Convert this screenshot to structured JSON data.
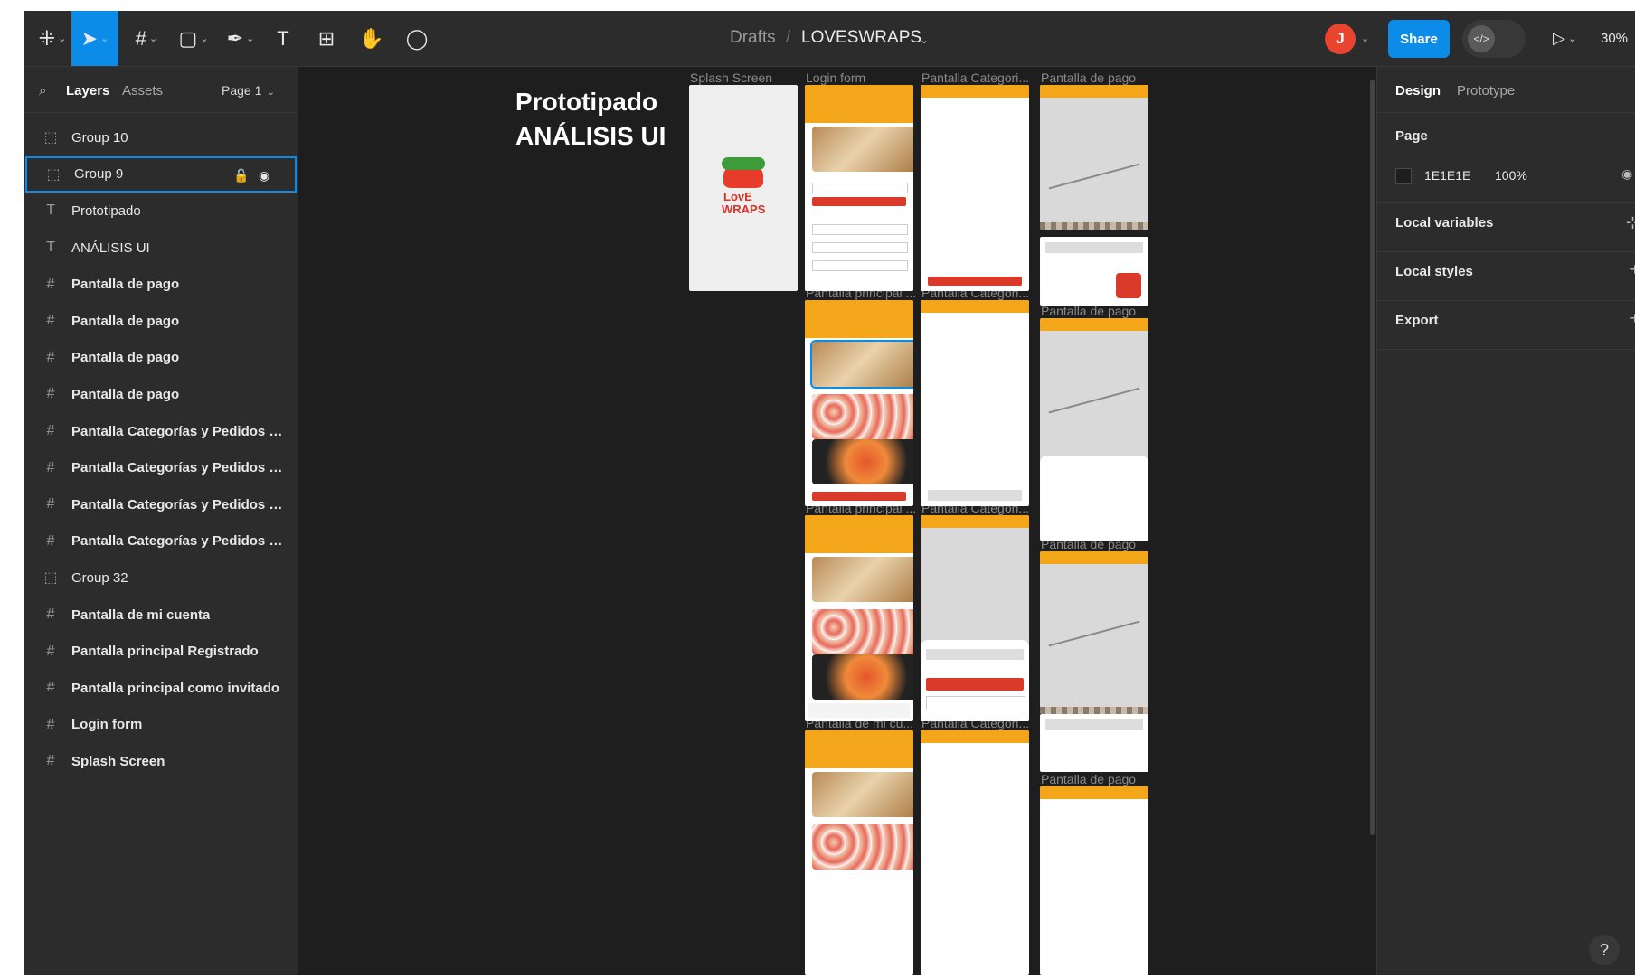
{
  "toolbar": {
    "main_menu_icon": "figma-logo-icon",
    "tools": [
      {
        "name": "move-tool",
        "icon": "pointer-icon",
        "active": true
      },
      {
        "name": "frame-tool",
        "icon": "hash-icon"
      },
      {
        "name": "shape-tool",
        "icon": "rectangle-icon"
      },
      {
        "name": "pen-tool",
        "icon": "pen-icon"
      },
      {
        "name": "text-tool",
        "icon": "text-icon"
      },
      {
        "name": "resources-tool",
        "icon": "components-icon"
      },
      {
        "name": "hand-tool",
        "icon": "hand-icon"
      },
      {
        "name": "comment-tool",
        "icon": "comment-icon"
      }
    ],
    "breadcrumb_drafts": "Drafts",
    "breadcrumb_sep": "/",
    "file_name": "LOVESWRAPS",
    "avatar_initial": "J",
    "share_label": "Share",
    "zoom": "30%",
    "accent_color": "#0c8ce9",
    "avatar_color": "#e8442f"
  },
  "left_panel": {
    "tab_layers": "Layers",
    "tab_assets": "Assets",
    "page_selector": "Page 1",
    "layers": [
      {
        "name": "Group 10",
        "type": "group"
      },
      {
        "name": "Group 9",
        "type": "group",
        "selected": true
      },
      {
        "name": "Prototipado",
        "type": "text"
      },
      {
        "name": "ANÁLISIS UI",
        "type": "text"
      },
      {
        "name": "Pantalla de pago",
        "type": "frame"
      },
      {
        "name": "Pantalla de pago",
        "type": "frame"
      },
      {
        "name": "Pantalla de pago",
        "type": "frame"
      },
      {
        "name": "Pantalla de pago",
        "type": "frame"
      },
      {
        "name": "Pantalla Categorías y Pedidos Re...",
        "type": "frame"
      },
      {
        "name": "Pantalla Categorías y Pedidos Re...",
        "type": "frame"
      },
      {
        "name": "Pantalla Categorías y Pedidos Re...",
        "type": "frame"
      },
      {
        "name": "Pantalla Categorías y Pedidos Re...",
        "type": "frame"
      },
      {
        "name": "Group 32",
        "type": "group"
      },
      {
        "name": "Pantalla de mi cuenta",
        "type": "frame"
      },
      {
        "name": "Pantalla principal Registrado",
        "type": "frame"
      },
      {
        "name": "Pantalla principal como invitado",
        "type": "frame"
      },
      {
        "name": "Login form",
        "type": "frame"
      },
      {
        "name": "Splash Screen",
        "type": "frame"
      }
    ]
  },
  "canvas": {
    "title_line1": "Prototipado",
    "title_line2": "ANÁLISIS UI",
    "frame_labels": {
      "splash": "Splash Screen",
      "login": "Login form",
      "categorias_1": "Pantalla Categori...",
      "pago_1": "Pantalla de pago",
      "principal_1": "Pantalla principal ...",
      "categorias_2": "Pantalla Categori...",
      "pago_2": "Pantalla de pago",
      "principal_2": "Pantalla principal ...",
      "categorias_3": "Pantalla Categori...",
      "pago_3": "Pantalla de pago",
      "micuenta": "Pantalla de mi cu...",
      "categorias_4": "Pantalla Categori...",
      "pago_4": "Pantalla de pago"
    },
    "splash_logo_line1": "LovE",
    "splash_logo_line2": "WRAPS",
    "brand_color": "#f3a61a",
    "button_color": "#d93a2a"
  },
  "right_panel": {
    "tab_design": "Design",
    "tab_prototype": "Prototype",
    "page_section": "Page",
    "page_color": "1E1E1E",
    "page_opacity": "100%",
    "local_variables": "Local variables",
    "local_styles": "Local styles",
    "export": "Export",
    "help": "?"
  }
}
